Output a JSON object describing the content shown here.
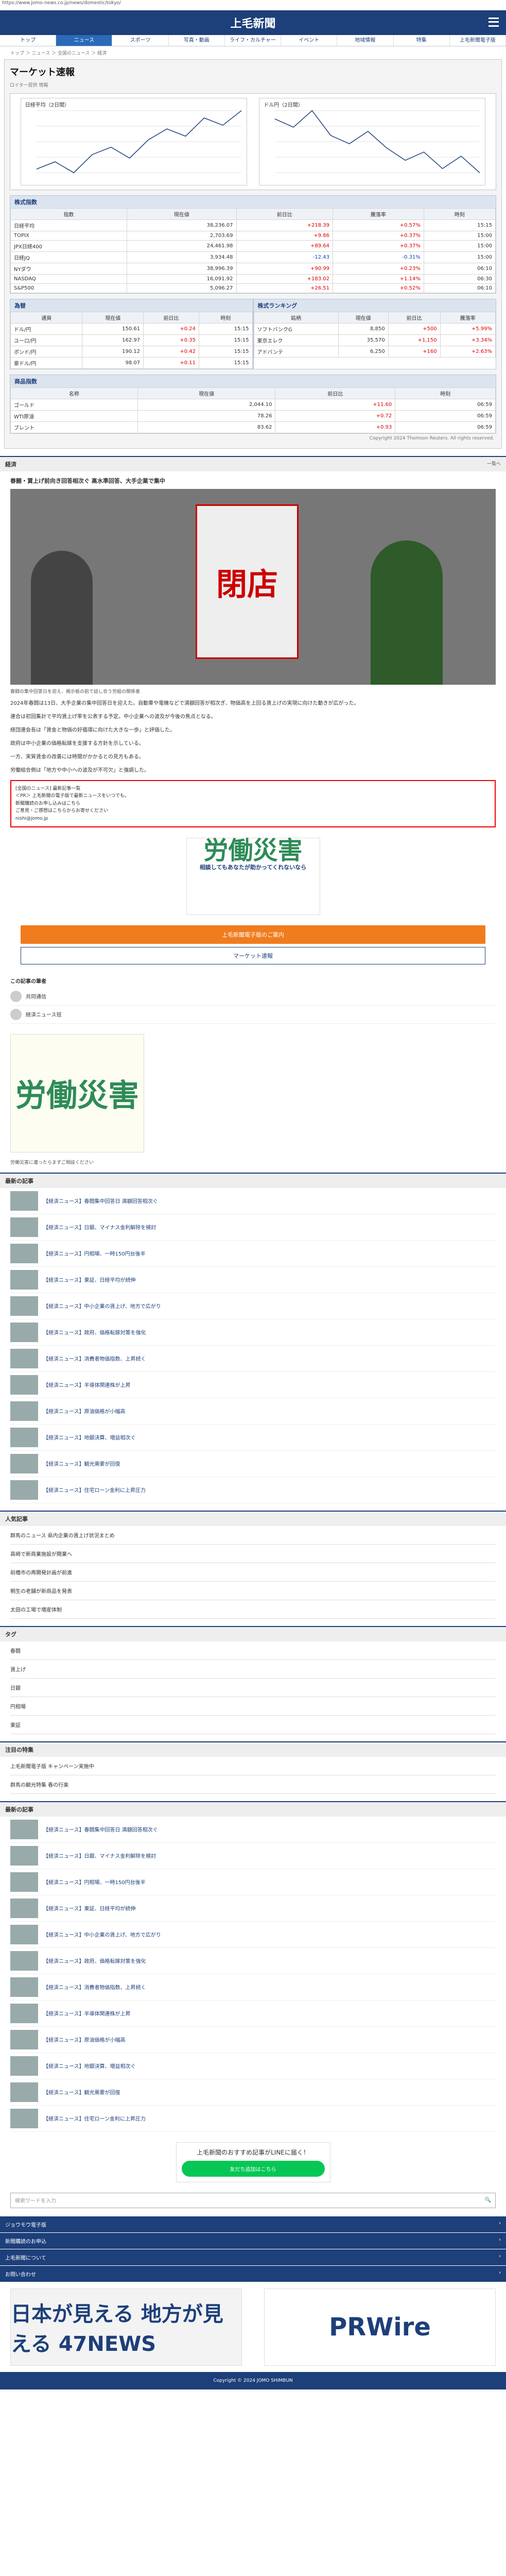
{
  "url": "https://www.jomo-news.co.jp/news/domestic/tokyo/",
  "site": {
    "logo": "上毛新聞"
  },
  "nav": [
    "トップ",
    "ニュース",
    "スポーツ",
    "写真・動画",
    "ライフ・カルチャー",
    "イベント",
    "地域情報",
    "特集",
    "上毛新聞電子版"
  ],
  "breadcrumb": "トップ ＞ ニュース ＞ 全国のニュース ＞ 経済",
  "market": {
    "title": "マーケット速報",
    "sub": "ロイター提供 情報",
    "search_btn": "検索",
    "charts": [
      {
        "label": "日経平均（2日間）",
        "values": [
          36,
          38,
          35,
          40,
          42,
          39,
          44,
          47,
          45,
          50,
          48,
          52
        ]
      },
      {
        "label": "ドル円（2日間）",
        "values": [
          50,
          48,
          52,
          46,
          44,
          47,
          43,
          40,
          42,
          38,
          41,
          37
        ]
      }
    ],
    "indices_title": "株式指数",
    "indices_headers": [
      "指数",
      "現在値",
      "前日比",
      "騰落率",
      "時刻"
    ],
    "indices": [
      [
        "日経平均",
        "38,236.07",
        "+218.39",
        "+0.57%",
        "15:15"
      ],
      [
        "TOPIX",
        "2,703.69",
        "+9.86",
        "+0.37%",
        "15:00"
      ],
      [
        "JPX日経400",
        "24,461.98",
        "+89.64",
        "+0.37%",
        "15:00"
      ],
      [
        "日経JQ",
        "3,934.48",
        "-12.43",
        "-0.31%",
        "15:00"
      ],
      [
        "NYダウ",
        "38,996.39",
        "+90.99",
        "+0.23%",
        "06:10"
      ],
      [
        "NASDAQ",
        "16,091.92",
        "+183.02",
        "+1.14%",
        "06:30"
      ],
      [
        "S&P500",
        "5,096.27",
        "+26.51",
        "+0.52%",
        "06:10"
      ]
    ],
    "fx_title": "為替",
    "fx_headers": [
      "通貨",
      "現在値",
      "前日比",
      "時刻"
    ],
    "fx": [
      [
        "ドル/円",
        "150.61",
        "+0.24",
        "15:15"
      ],
      [
        "ユーロ/円",
        "162.97",
        "+0.35",
        "15:15"
      ],
      [
        "ポンド/円",
        "190.12",
        "+0.42",
        "15:15"
      ],
      [
        "豪ドル/円",
        "98.07",
        "+0.11",
        "15:15"
      ]
    ],
    "ranking_title": "株式ランキング",
    "ranking_headers": [
      "銘柄",
      "現在値",
      "前日比",
      "騰落率"
    ],
    "ranking": [
      [
        "ソフトバンクG",
        "8,850",
        "+500",
        "+5.99%"
      ],
      [
        "東京エレク",
        "35,570",
        "+1,150",
        "+3.34%"
      ],
      [
        "アドバンテ",
        "6,250",
        "+160",
        "+2.63%"
      ]
    ],
    "commod_title": "商品指数",
    "commod_headers": [
      "名称",
      "現在値",
      "前日比",
      "時刻"
    ],
    "commod": [
      [
        "ゴールド",
        "2,044.10",
        "+11.60",
        "06:59"
      ],
      [
        "WTI原油",
        "78.26",
        "+0.72",
        "06:59"
      ],
      [
        "ブレント",
        "83.62",
        "+0.93",
        "06:59"
      ]
    ],
    "copyright": "Copyright 2024 Thomson Reuters. All rights reserved."
  },
  "article": {
    "section": "経済",
    "more": "一覧へ",
    "headline": "春闘・賃上げ前向き回答相次ぐ 高水準回答、大手企業で集中",
    "caption": "春闘の集中回答日を迎え、掲示板の前で話し合う労組の関係者",
    "paragraphs": [
      "2024年春闘は13日、大手企業の集中回答日を迎えた。自動車や電機などで満額回答が相次ぎ、物価高を上回る賃上げの実現に向けた動きが広がった。",
      "連合は初回集計で平均賃上げ率を公表する予定。中小企業への波及が今後の焦点となる。",
      "経団連会長は「賃金と物価の好循環に向けた大きな一歩」と評価した。",
      "政府は中小企業の価格転嫁を支援する方針を示している。",
      "一方、実質賃金の改善には時間がかかるとの見方もある。",
      "労働組合側は「地方や中小への波及が不可欠」と強調した。"
    ],
    "red_text": [
      "[全国のニュース] 最新記事一覧",
      "＜PR＞ 上毛新聞の電子版で最新ニュースをいつでも。",
      "新聞購読のお申し込みはこちら",
      "ご意見・ご感想はこちらからお寄せください",
      "nishi@jomo.jp"
    ],
    "ad_big": "労働災害",
    "ad_text": "相談してもあなたが助かってくれないなら",
    "orange_btn": "上毛新聞電子版のご案内",
    "blue_btn": "マーケット速報"
  },
  "writers": {
    "title": "この記事の筆者",
    "rows": [
      "共同通信",
      "経済ニュース班"
    ]
  },
  "related": {
    "big": "労働災害",
    "caption": "労働災害に遭ったらまずご相談ください"
  },
  "latest": {
    "title": "最新の記事",
    "items": [
      "【経済ニュース】春闘集中回答日 満額回答相次ぐ",
      "【経済ニュース】日銀、マイナス金利解除を検討",
      "【経済ニュース】円相場、一時150円台後半",
      "【経済ニュース】東証、日経平均が続伸",
      "【経済ニュース】中小企業の賃上げ、地方で広がり",
      "【経済ニュース】政府、価格転嫁対策を強化",
      "【経済ニュース】消費者物価指数、上昇続く",
      "【経済ニュース】半導体関連株が上昇",
      "【経済ニュース】原油価格が小幅高",
      "【経済ニュース】地銀決算、増益相次ぐ",
      "【経済ニュース】観光需要が回復",
      "【経済ニュース】住宅ローン金利に上昇圧力"
    ]
  },
  "popular": {
    "title": "人気記事",
    "rows": [
      "群馬のニュース 県内企業の賃上げ状況まとめ",
      "高崎で新商業施設が開業へ",
      "前橋市の再開発計画が前進",
      "桐生の老舗が新商品を発表",
      "太田の工場で増産体制"
    ]
  },
  "tags": {
    "title": "タグ",
    "rows": [
      "春闘",
      "賃上げ",
      "日銀",
      "円相場",
      "東証"
    ]
  },
  "pr_items": {
    "title": "注目の特集",
    "rows": [
      "上毛新聞電子版 キャンペーン実施中",
      "群馬の観光特集 春の行楽"
    ]
  },
  "latest2": {
    "title": "最新の記事"
  },
  "line": {
    "title": "上毛新聞のおすすめ記事がLINEに届く！",
    "btn": "友だち追加はこちら"
  },
  "search": {
    "placeholder": "検索ワードを入力"
  },
  "footer_links": [
    "ジョウモウ電子版",
    "新聞購読のお申込",
    "上毛新聞について",
    "お問い合わせ"
  ],
  "banners": [
    "日本が見える 地方が見える 47NEWS",
    "PRWire"
  ],
  "bottom_copy": "Copyright © 2024 JOMO SHIMBUN"
}
